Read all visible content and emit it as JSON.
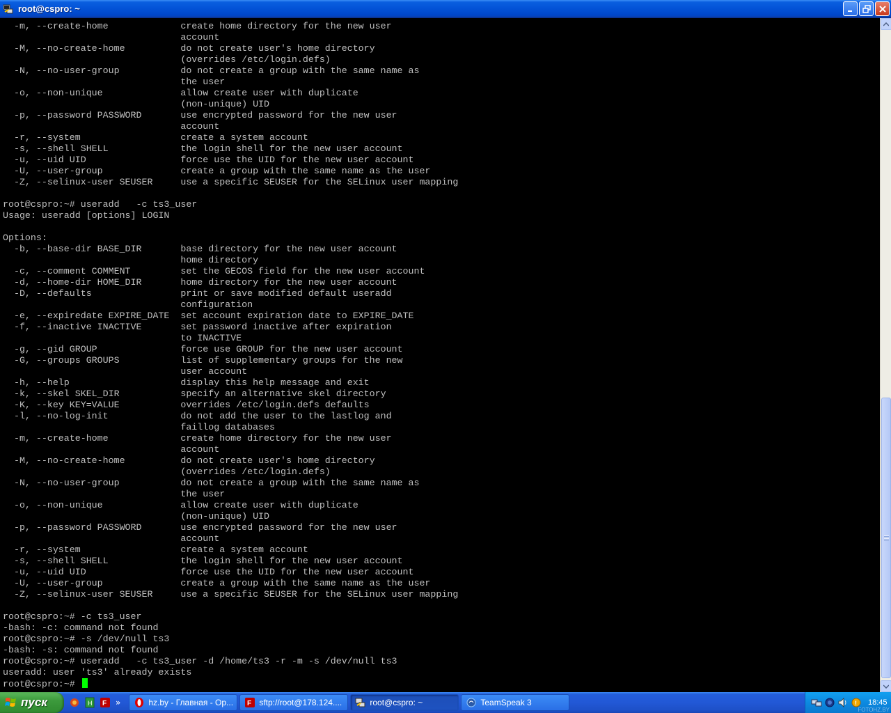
{
  "window": {
    "title": "root@cspro: ~"
  },
  "terminal": {
    "lines": [
      "  -m, --create-home             create home directory for the new user",
      "                                account",
      "  -M, --no-create-home          do not create user's home directory",
      "                                (overrides /etc/login.defs)",
      "  -N, --no-user-group           do not create a group with the same name as",
      "                                the user",
      "  -o, --non-unique              allow create user with duplicate",
      "                                (non-unique) UID",
      "  -p, --password PASSWORD       use encrypted password for the new user",
      "                                account",
      "  -r, --system                  create a system account",
      "  -s, --shell SHELL             the login shell for the new user account",
      "  -u, --uid UID                 force use the UID for the new user account",
      "  -U, --user-group              create a group with the same name as the user",
      "  -Z, --selinux-user SEUSER     use a specific SEUSER for the SELinux user mapping",
      "",
      "root@cspro:~# useradd   -c ts3_user",
      "Usage: useradd [options] LOGIN",
      "",
      "Options:",
      "  -b, --base-dir BASE_DIR       base directory for the new user account",
      "                                home directory",
      "  -c, --comment COMMENT         set the GECOS field for the new user account",
      "  -d, --home-dir HOME_DIR       home directory for the new user account",
      "  -D, --defaults                print or save modified default useradd",
      "                                configuration",
      "  -e, --expiredate EXPIRE_DATE  set account expiration date to EXPIRE_DATE",
      "  -f, --inactive INACTIVE       set password inactive after expiration",
      "                                to INACTIVE",
      "  -g, --gid GROUP               force use GROUP for the new user account",
      "  -G, --groups GROUPS           list of supplementary groups for the new",
      "                                user account",
      "  -h, --help                    display this help message and exit",
      "  -k, --skel SKEL_DIR           specify an alternative skel directory",
      "  -K, --key KEY=VALUE           overrides /etc/login.defs defaults",
      "  -l, --no-log-init             do not add the user to the lastlog and",
      "                                faillog databases",
      "  -m, --create-home             create home directory for the new user",
      "                                account",
      "  -M, --no-create-home          do not create user's home directory",
      "                                (overrides /etc/login.defs)",
      "  -N, --no-user-group           do not create a group with the same name as",
      "                                the user",
      "  -o, --non-unique              allow create user with duplicate",
      "                                (non-unique) UID",
      "  -p, --password PASSWORD       use encrypted password for the new user",
      "                                account",
      "  -r, --system                  create a system account",
      "  -s, --shell SHELL             the login shell for the new user account",
      "  -u, --uid UID                 force use the UID for the new user account",
      "  -U, --user-group              create a group with the same name as the user",
      "  -Z, --selinux-user SEUSER     use a specific SEUSER for the SELinux user mapping",
      "",
      "root@cspro:~# -c ts3_user",
      "-bash: -c: command not found",
      "root@cspro:~# -s /dev/null ts3",
      "-bash: -s: command not found",
      "root@cspro:~# useradd   -c ts3_user -d /home/ts3 -r -m -s /dev/null ts3",
      "useradd: user 'ts3' already exists"
    ],
    "prompt": "root@cspro:~# "
  },
  "taskbar": {
    "start_label": "пуск",
    "tasks": [
      {
        "label": "hz.by - Главная - Op...",
        "icon": "opera-icon",
        "active": false
      },
      {
        "label": "sftp://root@178.124....",
        "icon": "filezilla-icon",
        "active": false
      },
      {
        "label": "root@cspro: ~",
        "icon": "putty-icon",
        "active": true
      },
      {
        "label": "TeamSpeak 3",
        "icon": "teamspeak-icon",
        "active": false
      }
    ],
    "clock": "18:45",
    "watermark": "FOTOHZ.BY"
  },
  "colors": {
    "terminal_bg": "#000000",
    "terminal_fg": "#c0c0c0",
    "cursor": "#00ff00",
    "titlebar": "#0352d6",
    "taskbar": "#2258d6",
    "start": "#3c9a3c"
  }
}
